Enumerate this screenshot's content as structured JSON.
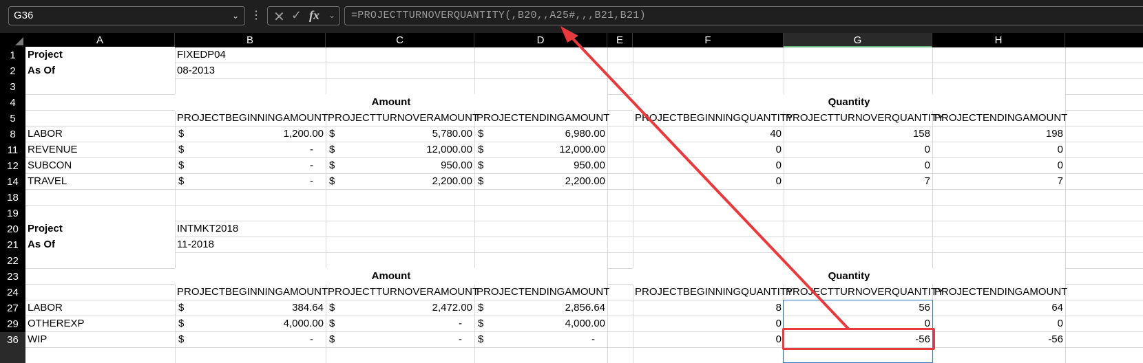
{
  "formula_bar": {
    "name_box": "G36",
    "formula": "=PROJECTTURNOVERQUANTITY(,B20,,A25#,,,B21,B21)",
    "cancel_icon": "x-icon",
    "enter_icon": "check-icon",
    "fx_label": "fx"
  },
  "columns": [
    "A",
    "B",
    "C",
    "D",
    "E",
    "F",
    "G",
    "H"
  ],
  "rows": [
    "1",
    "2",
    "3",
    "4",
    "5",
    "8",
    "11",
    "12",
    "14",
    "18",
    "19",
    "20",
    "21",
    "22",
    "23",
    "24",
    "27",
    "29",
    "36"
  ],
  "cells": {
    "project_label": "Project",
    "asof_label": "As Of",
    "project1": "FIXEDP04",
    "asof1": "08-2013",
    "amount_header": "Amount",
    "quantity_header": "Quantity",
    "h_beg_amt": "PROJECTBEGINNINGAMOUNT",
    "h_turn_amt": "PROJECTTURNOVERAMOUNT",
    "h_end_amt": "PROJECTENDINGAMOUNT",
    "h_beg_qty": "PROJECTBEGINNINGQUANTITY",
    "h_turn_qty": "PROJECTTURNOVERQUANTITY",
    "h_end_qty": "PROJECTENDINGAMOUNT",
    "currency": "$",
    "project2": "INTMKT2018",
    "asof2": "11-2018"
  },
  "table1": [
    {
      "label": "LABOR",
      "beg": "1,200.00",
      "turn": "5,780.00",
      "end": "6,980.00",
      "qbeg": "40",
      "qturn": "158",
      "qend": "198"
    },
    {
      "label": "REVENUE",
      "beg": "-",
      "turn": "12,000.00",
      "end": "12,000.00",
      "qbeg": "0",
      "qturn": "0",
      "qend": "0"
    },
    {
      "label": "SUBCON",
      "beg": "-",
      "turn": "950.00",
      "end": "950.00",
      "qbeg": "0",
      "qturn": "0",
      "qend": "0"
    },
    {
      "label": "TRAVEL",
      "beg": "-",
      "turn": "2,200.00",
      "end": "2,200.00",
      "qbeg": "0",
      "qturn": "7",
      "qend": "7"
    }
  ],
  "table2": [
    {
      "label": "LABOR",
      "beg": "384.64",
      "turn": "2,472.00",
      "end": "2,856.64",
      "qbeg": "8",
      "qturn": "56",
      "qend": "64"
    },
    {
      "label": "OTHEREXP",
      "beg": "4,000.00",
      "turn": "-",
      "end": "4,000.00",
      "qbeg": "0",
      "qturn": "0",
      "qend": "0"
    },
    {
      "label": "WIP",
      "beg": "-",
      "turn": "-",
      "end": "-",
      "qbeg": "0",
      "qturn": "-56",
      "qend": "-56"
    }
  ],
  "colors": {
    "highlight_red": "#e8393d",
    "selection_blue": "#2f78c4",
    "selected_header_green": "#6bb37e"
  }
}
